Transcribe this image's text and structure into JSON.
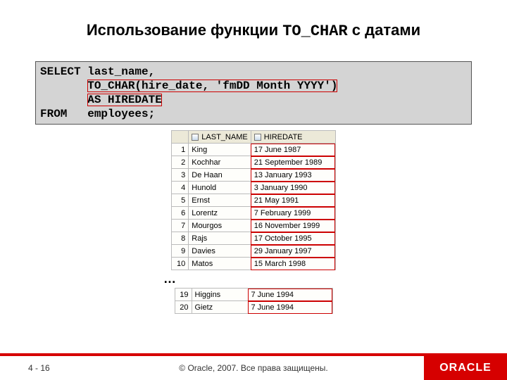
{
  "title": {
    "prefix": "Использование функции ",
    "code": "TO_CHAR",
    "suffix": " с датами"
  },
  "sql": {
    "line1": "SELECT last_name,",
    "line2_indent": "       ",
    "line2_code": "TO_CHAR(hire_date, 'fmDD Month YYYY')",
    "line3_indent": "       ",
    "line3_code": "AS HIREDATE",
    "line4": "FROM   employees;"
  },
  "headers": {
    "lname": "LAST_NAME",
    "hdate": "HIREDATE"
  },
  "rows1": [
    {
      "n": "1",
      "lname": "King",
      "hdate": "17 June 1987"
    },
    {
      "n": "2",
      "lname": "Kochhar",
      "hdate": "21 September 1989"
    },
    {
      "n": "3",
      "lname": "De Haan",
      "hdate": "13 January 1993"
    },
    {
      "n": "4",
      "lname": "Hunold",
      "hdate": "3 January 1990"
    },
    {
      "n": "5",
      "lname": "Ernst",
      "hdate": "21 May 1991"
    },
    {
      "n": "6",
      "lname": "Lorentz",
      "hdate": "7 February 1999"
    },
    {
      "n": "7",
      "lname": "Mourgos",
      "hdate": "16 November 1999"
    },
    {
      "n": "8",
      "lname": "Rajs",
      "hdate": "17 October 1995"
    },
    {
      "n": "9",
      "lname": "Davies",
      "hdate": "29 January 1997"
    },
    {
      "n": "10",
      "lname": "Matos",
      "hdate": "15 March 1998"
    }
  ],
  "ellipsis": "…",
  "rows2": [
    {
      "n": "19",
      "lname": "Higgins",
      "hdate": "7 June 1994"
    },
    {
      "n": "20",
      "lname": "Gietz",
      "hdate": "7 June 1994"
    }
  ],
  "footer": {
    "page": "4 - 16",
    "copyright": "© Oracle, 2007. Все права защищены.",
    "logo": "ORACLE"
  }
}
